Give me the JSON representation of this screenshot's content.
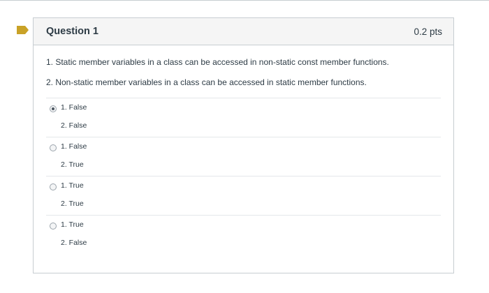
{
  "question": {
    "title": "Question 1",
    "points": "0.2 pts",
    "statements": [
      "1. Static member variables in a class can be accessed in non-static const member functions.",
      "2. Non-static member variables in a class can be accessed in static member functions."
    ],
    "answers": [
      {
        "line1": "1. False",
        "line2": "2. False",
        "selected": true
      },
      {
        "line1": "1. False",
        "line2": "2. True",
        "selected": false
      },
      {
        "line1": "1. True",
        "line2": "2. True",
        "selected": false
      },
      {
        "line1": "1. True",
        "line2": "2. False",
        "selected": false
      }
    ]
  },
  "colors": {
    "flag": "#c9a227",
    "border": "#c7cdd1",
    "header_bg": "#f5f5f5",
    "text": "#2d3b45"
  },
  "icons": {
    "flag": "bookmark-flag-icon",
    "radio": "radio-button-icon"
  }
}
